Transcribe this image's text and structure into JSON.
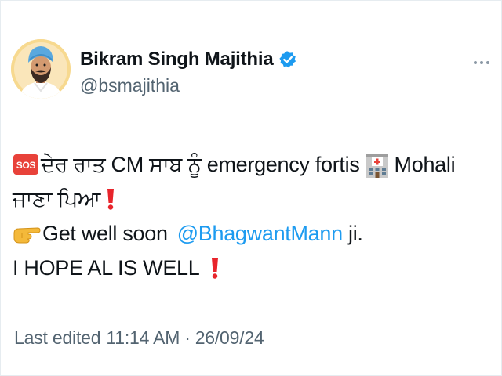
{
  "author": {
    "display_name": "Bikram Singh Majithia",
    "handle": "@bsmajithia",
    "verified": true,
    "icons": {
      "avatar": "avatar-photo",
      "verified": "verified-badge-icon",
      "more": "more-options-icon"
    }
  },
  "tweet": {
    "line1": {
      "text_a": "ਦੇਰ ਰਾਤ CM ਸਾਬ ਨੂੰ emergency fortis",
      "text_b": "Mohali"
    },
    "line2": {
      "text": "ਜਾਣਾ ਪਿਆ"
    },
    "line3": {
      "text": "Get well soon",
      "mention": "@BhagwantMann",
      "suffix": " ji."
    },
    "line4": {
      "text": "I HOPE AL IS WELL"
    },
    "emoji": [
      "sos-icon",
      "hospital-icon",
      "red-exclamation-icon",
      "pointing-hand-icon"
    ]
  },
  "meta": {
    "edited_label": "Last edited",
    "time": "11:14 AM",
    "separator": "·",
    "date": "26/09/24"
  },
  "colors": {
    "text": "#0f1419",
    "secondary": "#536471",
    "link": "#1d9bf0",
    "verified": "#1d9bf0",
    "sos": "#e8423a",
    "exclaim": "#e8242b"
  }
}
